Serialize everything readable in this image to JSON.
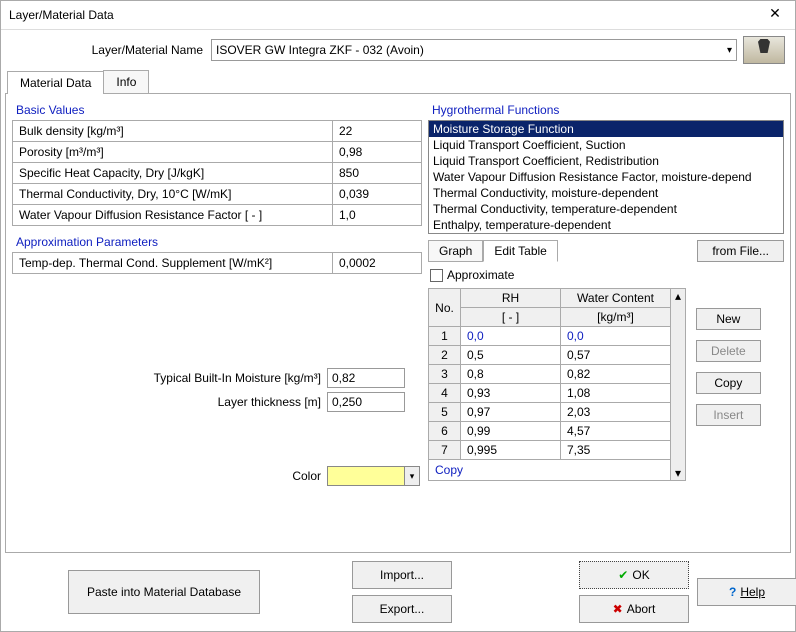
{
  "window": {
    "title": "Layer/Material Data"
  },
  "header": {
    "name_label": "Layer/Material Name",
    "material_name": "ISOVER  GW  Integra  ZKF - 032 (Avoin)"
  },
  "tabs": {
    "material_data": "Material Data",
    "info": "Info"
  },
  "basic": {
    "title": "Basic Values",
    "rows": [
      {
        "label": "Bulk density [kg/m³]",
        "value": "22"
      },
      {
        "label": "Porosity [m³/m³]",
        "value": "0,98"
      },
      {
        "label": "Specific Heat Capacity, Dry [J/kgK]",
        "value": "850"
      },
      {
        "label": "Thermal Conductivity, Dry, 10°C [W/mK]",
        "value": "0,039"
      },
      {
        "label": "Water Vapour Diffusion Resistance Factor [ - ]",
        "value": "1,0"
      }
    ]
  },
  "approx": {
    "title": "Approximation Parameters",
    "rows": [
      {
        "label": "Temp-dep. Thermal Cond. Supplement [W/mK²]",
        "value": "0,0002"
      }
    ]
  },
  "fields": {
    "moisture_label": "Typical Built-In Moisture [kg/m³]",
    "moisture_value": "0,82",
    "thickness_label": "Layer thickness [m]",
    "thickness_value": "0,250",
    "color_label": "Color"
  },
  "hygro": {
    "title": "Hygrothermal Functions",
    "items": [
      "Moisture Storage Function",
      "Liquid Transport Coefficient, Suction",
      "Liquid Transport Coefficient, Redistribution",
      "Water Vapour Diffusion Resistance Factor, moisture-depend",
      "Thermal Conductivity, moisture-dependent",
      "Thermal Conductivity, temperature-dependent",
      "Enthalpy, temperature-dependent"
    ],
    "selected": 0
  },
  "subtabs": {
    "graph": "Graph",
    "edit": "Edit Table",
    "from_file": "from File..."
  },
  "table": {
    "approximate": "Approximate",
    "headers": {
      "no": "No.",
      "rh": "RH",
      "rh_unit": "[ - ]",
      "wc": "Water Content",
      "wc_unit": "[kg/m³]"
    },
    "rows": [
      {
        "n": "1",
        "rh": "0,0",
        "wc": "0,0"
      },
      {
        "n": "2",
        "rh": "0,5",
        "wc": "0,57"
      },
      {
        "n": "3",
        "rh": "0,8",
        "wc": "0,82"
      },
      {
        "n": "4",
        "rh": "0,93",
        "wc": "1,08"
      },
      {
        "n": "5",
        "rh": "0,97",
        "wc": "2,03"
      },
      {
        "n": "6",
        "rh": "0,99",
        "wc": "4,57"
      },
      {
        "n": "7",
        "rh": "0,995",
        "wc": "7,35"
      }
    ],
    "copy": "Copy"
  },
  "sidebuttons": {
    "new": "New",
    "delete": "Delete",
    "copy": "Copy",
    "insert": "Insert"
  },
  "footer": {
    "paste": "Paste into Material Database",
    "import": "Import...",
    "export": "Export...",
    "ok": "OK",
    "abort": "Abort",
    "help": "Help"
  }
}
